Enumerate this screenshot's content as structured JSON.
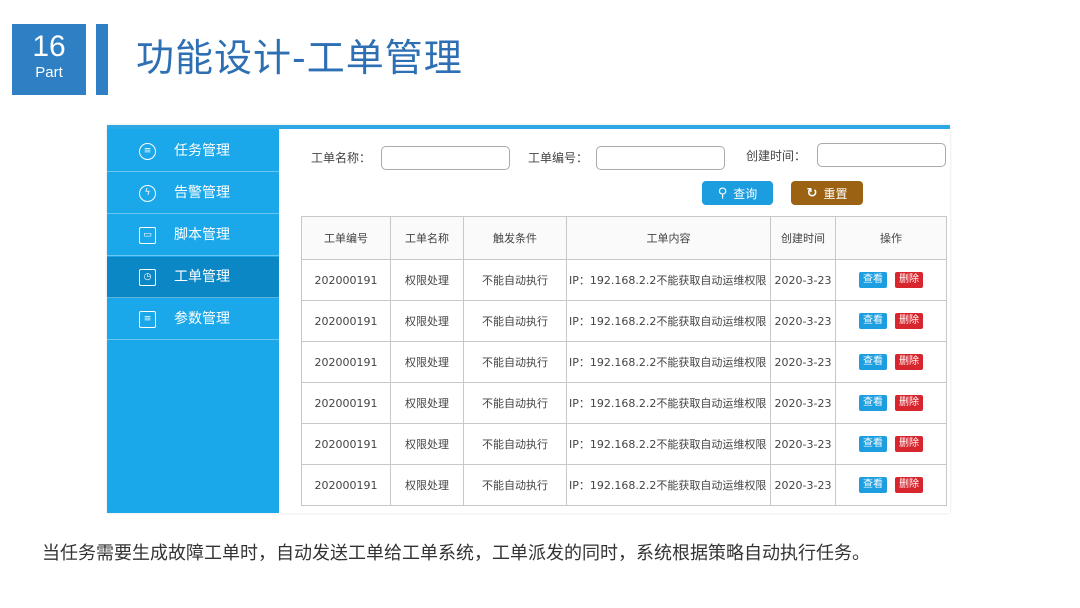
{
  "slide": {
    "number": "16",
    "part_label": "Part",
    "title": "功能设计-工单管理",
    "caption": "当任务需要生成故障工单时，自动发送工单给工单系统，工单派发的同时，系统根据策略自动执行任务。"
  },
  "sidebar": {
    "items": [
      {
        "label": "任务管理",
        "icon": "task-icon",
        "active": false
      },
      {
        "label": "告警管理",
        "icon": "alarm-icon",
        "active": false
      },
      {
        "label": "脚本管理",
        "icon": "script-icon",
        "active": false
      },
      {
        "label": "工单管理",
        "icon": "workorder-icon",
        "active": true
      },
      {
        "label": "参数管理",
        "icon": "param-icon",
        "active": false
      }
    ]
  },
  "search": {
    "name_label": "工单名称：",
    "name_value": "",
    "number_label": "工单编号：",
    "number_value": "",
    "time_label": "创建时间：",
    "time_value": "",
    "search_button": "查询",
    "reset_button": "重置"
  },
  "table": {
    "headers": [
      "工单编号",
      "工单名称",
      "触发条件",
      "工单内容",
      "创建时间",
      "操作"
    ],
    "view_label": "查看",
    "delete_label": "删除",
    "rows": [
      [
        "202000191",
        "权限处理",
        "不能自动执行",
        "IP：192.168.2.2不能获取自动运维权限",
        "2020-3-23"
      ],
      [
        "202000191",
        "权限处理",
        "不能自动执行",
        "IP：192.168.2.2不能获取自动运维权限",
        "2020-3-23"
      ],
      [
        "202000191",
        "权限处理",
        "不能自动执行",
        "IP：192.168.2.2不能获取自动运维权限",
        "2020-3-23"
      ],
      [
        "202000191",
        "权限处理",
        "不能自动执行",
        "IP：192.168.2.2不能获取自动运维权限",
        "2020-3-23"
      ],
      [
        "202000191",
        "权限处理",
        "不能自动执行",
        "IP：192.168.2.2不能获取自动运维权限",
        "2020-3-23"
      ],
      [
        "202000191",
        "权限处理",
        "不能自动执行",
        "IP：192.168.2.2不能获取自动运维权限",
        "2020-3-23"
      ]
    ]
  },
  "colors": {
    "brand": "#2e7fc3",
    "sidebar": "#1aa8ea",
    "sidebar_active": "#0c87c5",
    "search_button": "#1b9de0",
    "reset_button": "#9a6212",
    "delete_button": "#d8262e"
  }
}
